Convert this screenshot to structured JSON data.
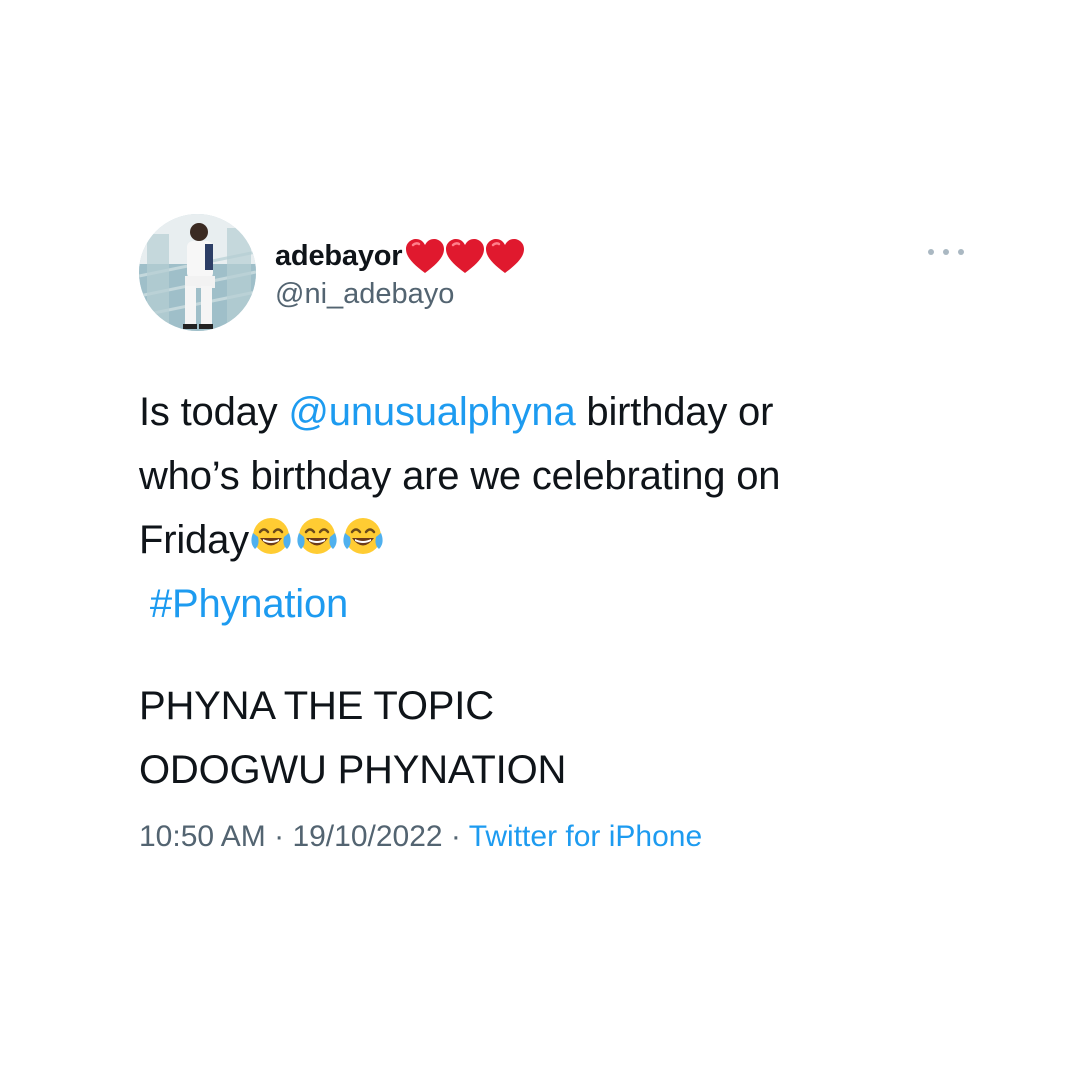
{
  "author": {
    "display_name": "adebayor",
    "handle": "@ni_adebayo",
    "name_emoji_icons": [
      "red-heart-icon",
      "red-heart-icon",
      "red-heart-icon"
    ]
  },
  "more_icon": "more-horizontal-icon",
  "tweet": {
    "line1_prefix": "Is today ",
    "mention": "@unusualphyna",
    "line1_suffix": " birthday or",
    "line2": "who’s birthday are we celebrating on",
    "line3": "Friday",
    "line3_emoji_icons": [
      "face-with-tears-of-joy-icon",
      "face-with-tears-of-joy-icon",
      "face-with-tears-of-joy-icon"
    ],
    "hashtag": "#Phynation",
    "line5": "PHYNA THE TOPIC",
    "line6": "ODOGWU PHYNATION"
  },
  "meta": {
    "time": "10:50 AM",
    "separator": " · ",
    "date": "19/10/2022",
    "source": "Twitter for iPhone"
  },
  "colors": {
    "link": "#1d9bf0",
    "secondary_text": "#536471",
    "heart": "#e0192e",
    "more_dots": "#aab8c2"
  }
}
